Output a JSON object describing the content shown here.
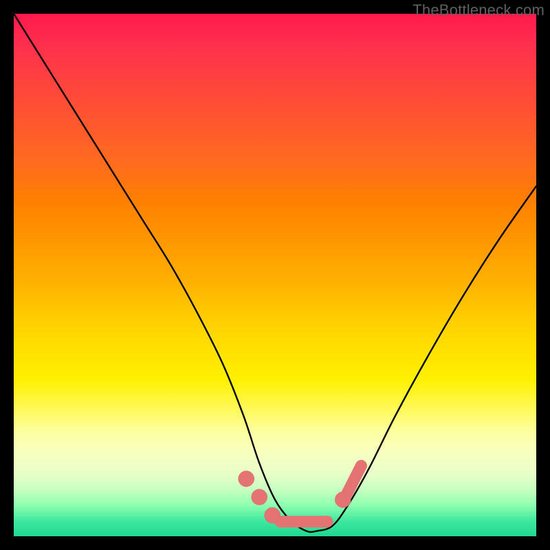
{
  "watermark": {
    "text": "TheBottleneck.com"
  },
  "palette": {
    "curve_stroke": "#000000",
    "marker_fill": "#e57373",
    "marker_stroke": "#d86868"
  },
  "chart_data": {
    "type": "line",
    "title": "",
    "xlabel": "",
    "ylabel": "",
    "xlim": [
      0,
      100
    ],
    "ylim": [
      0,
      100
    ],
    "grid": false,
    "legend": null,
    "series": [
      {
        "name": "bottleneck-curve",
        "x": [
          0,
          5,
          10,
          15,
          20,
          25,
          30,
          35,
          40,
          44,
          47,
          50,
          53,
          56,
          58,
          61,
          64,
          68,
          73,
          79,
          86,
          93,
          100
        ],
        "values": [
          100,
          92,
          84,
          76,
          68,
          60,
          52,
          43,
          33,
          23,
          14,
          7,
          3,
          1,
          1,
          2,
          6,
          13,
          23,
          34,
          46,
          57,
          67
        ]
      }
    ],
    "markers": [
      {
        "x": 44.5,
        "y": 11.0,
        "r": 1.1
      },
      {
        "x": 47.0,
        "y": 7.5,
        "r": 1.1
      },
      {
        "x": 49.5,
        "y": 4.0,
        "r": 1.1
      },
      {
        "x": 63.0,
        "y": 7.0,
        "r": 1.1
      }
    ],
    "marker_bars": [
      {
        "x1": 51.0,
        "y1": 2.8,
        "x2": 60.0,
        "y2": 2.8
      },
      {
        "x1": 63.8,
        "y1": 8.2,
        "x2": 66.5,
        "y2": 13.5
      }
    ]
  }
}
